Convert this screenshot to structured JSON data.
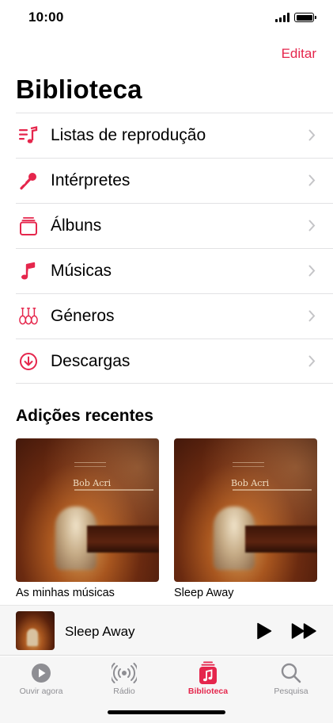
{
  "status_bar": {
    "time": "10:00"
  },
  "header": {
    "edit_label": "Editar",
    "title": "Biblioteca"
  },
  "library_items": [
    {
      "label": "Listas de reprodução",
      "icon": "playlist-icon"
    },
    {
      "label": "Intérpretes",
      "icon": "microphone-icon"
    },
    {
      "label": "Álbuns",
      "icon": "album-stack-icon"
    },
    {
      "label": "Músicas",
      "icon": "music-note-icon"
    },
    {
      "label": "Géneros",
      "icon": "guitars-icon"
    },
    {
      "label": "Descargas",
      "icon": "download-circle-icon"
    }
  ],
  "recent": {
    "section_title": "Adições recentes",
    "albums": [
      {
        "title": "As minhas músicas",
        "cover_text": "Bob Acri"
      },
      {
        "title": "Sleep Away",
        "cover_text": "Bob Acri"
      }
    ]
  },
  "mini_player": {
    "track": "Sleep Away"
  },
  "tabs": [
    {
      "label": "Ouvir agora",
      "icon": "play-circle-icon",
      "active": false
    },
    {
      "label": "Rádio",
      "icon": "radio-waves-icon",
      "active": false
    },
    {
      "label": "Biblioteca",
      "icon": "library-icon",
      "active": true
    },
    {
      "label": "Pesquisa",
      "icon": "search-icon",
      "active": false
    }
  ],
  "colors": {
    "accent": "#e5264c",
    "tab_inactive": "#8e8e93",
    "background": "#ffffff",
    "bar_background": "#f6f6f6"
  }
}
